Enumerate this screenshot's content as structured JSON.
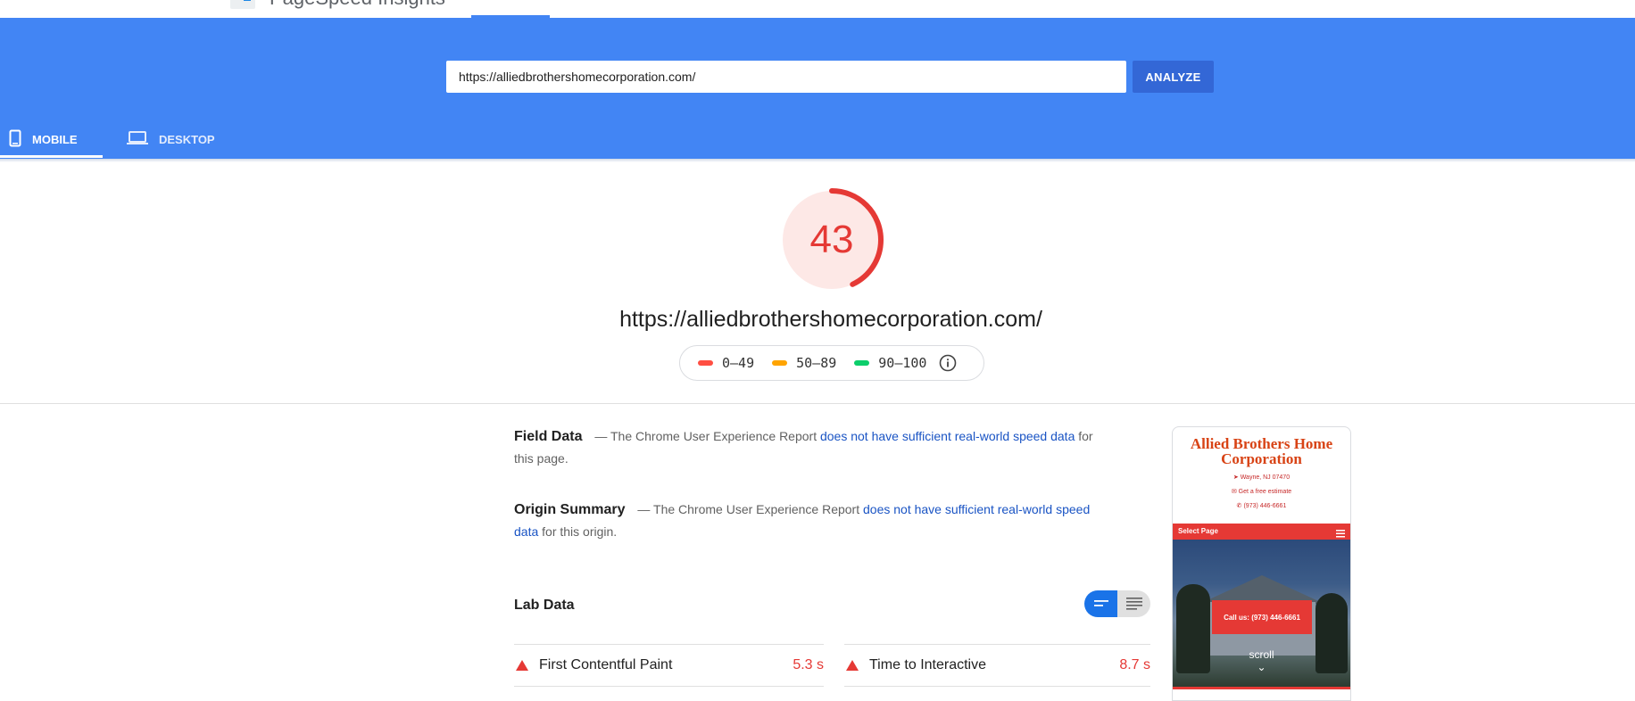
{
  "app": {
    "name": "PageSpeed Insights"
  },
  "search": {
    "url_value": "https://alliedbrothershomecorporation.com/",
    "analyze_label": "ANALYZE"
  },
  "tabs": [
    {
      "label": "MOBILE",
      "active": true
    },
    {
      "label": "DESKTOP",
      "active": false
    }
  ],
  "score": {
    "value": "43",
    "fraction": 0.43,
    "color": "#e53935",
    "background": "#fde8e6"
  },
  "tested_url": "https://alliedbrothershomecorporation.com/",
  "legend": [
    {
      "range": "0–49",
      "color": "#ff4e42"
    },
    {
      "range": "50–89",
      "color": "#ffa400"
    },
    {
      "range": "90–100",
      "color": "#0cce6b"
    }
  ],
  "field_data": {
    "title": "Field Data",
    "prefix": "— The Chrome User Experience Report",
    "link": "does not have sufficient real-world speed data",
    "suffix": "for this page."
  },
  "origin_summary": {
    "title": "Origin Summary",
    "prefix": "— The Chrome User Experience Report",
    "link": "does not have sufficient real-world speed data",
    "suffix": "for this origin."
  },
  "lab_data": {
    "title": "Lab Data",
    "metrics": [
      {
        "name": "First Contentful Paint",
        "value": "5.3 s",
        "status": "fail"
      },
      {
        "name": "Time to Interactive",
        "value": "8.7 s",
        "status": "fail"
      }
    ]
  },
  "thumbnail": {
    "site_title": "Allied Brothers Home Corporation",
    "location": "Wayne, NJ 07470",
    "estimate": "Get a free estimate",
    "phone": "(973) 446-6661",
    "nav_label": "Select Page",
    "cta": "Call us: (973) 446-6661",
    "scroll": "scroll"
  }
}
